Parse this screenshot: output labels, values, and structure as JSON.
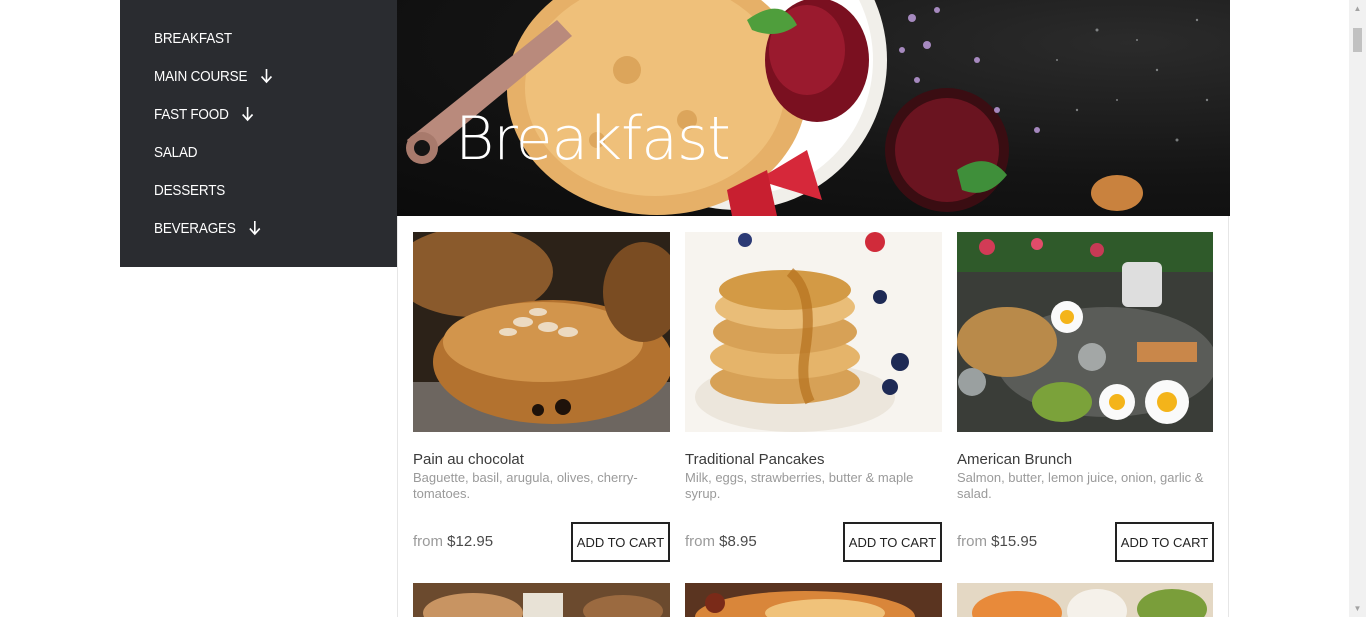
{
  "sidebar": {
    "items": [
      {
        "label": "BREAKFAST",
        "has_arrow": false
      },
      {
        "label": "MAIN COURSE",
        "has_arrow": true
      },
      {
        "label": "FAST FOOD",
        "has_arrow": true
      },
      {
        "label": "SALAD",
        "has_arrow": false
      },
      {
        "label": "DESSERTS",
        "has_arrow": false
      },
      {
        "label": "BEVERAGES",
        "has_arrow": true
      }
    ]
  },
  "hero": {
    "title": "Breakfast"
  },
  "products": [
    {
      "title": "Pain au chocolat",
      "desc": "Baguette, basil, arugula, olives, cherry-tomatoes.",
      "price_prefix": "from",
      "price": "$12.95",
      "button": "ADD TO CART"
    },
    {
      "title": "Traditional Pancakes",
      "desc": "Milk, eggs, strawberries, butter & maple syrup.",
      "price_prefix": "from",
      "price": "$8.95",
      "button": "ADD TO CART"
    },
    {
      "title": "American Brunch",
      "desc": "Salmon, butter, lemon juice, onion, garlic & salad.",
      "price_prefix": "from",
      "price": "$15.95",
      "button": "ADD TO CART"
    }
  ],
  "colors": {
    "sidebar_bg": "#2a2c30",
    "text_dark": "#3b3b3b",
    "text_muted": "#9a9a9a"
  }
}
